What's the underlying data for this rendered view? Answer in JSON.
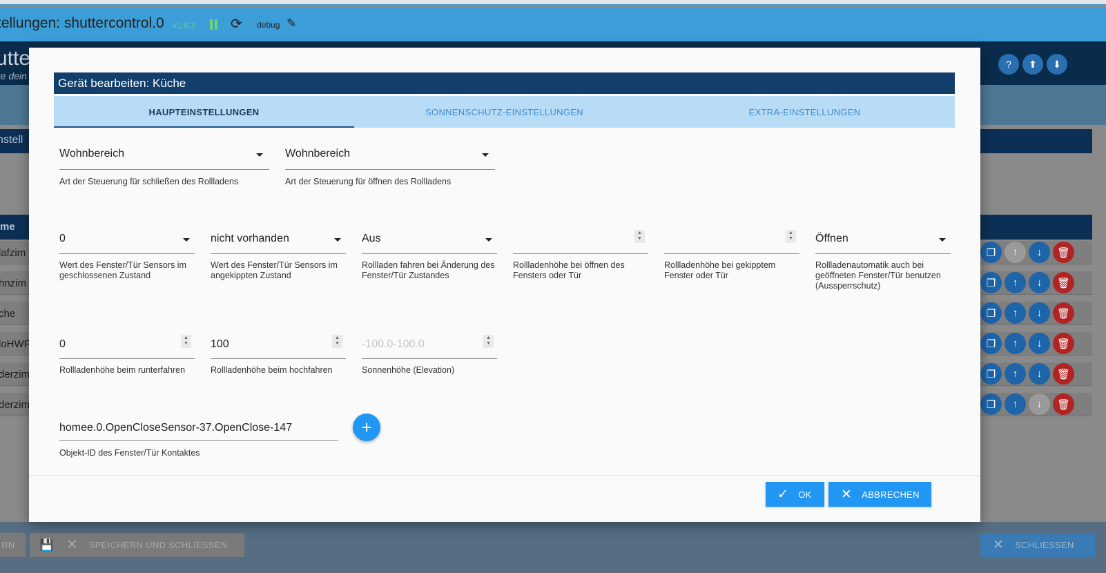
{
  "app": {
    "title": "tellungen: shuttercontrol.0",
    "version": "v1.6.2",
    "debug_label": "debug",
    "header_name": "utte",
    "header_sub": "re dein",
    "section_label": "nstell",
    "table_header": "me",
    "rows": [
      "lafzim",
      "hnzim",
      "che",
      "loHWF",
      "derzim",
      "derzim"
    ]
  },
  "footer": {
    "left_label": "RN",
    "save_close_label": "SPEICHERN UND SCHLIESSEN",
    "close_label": "SCHLIESSEN"
  },
  "dialog": {
    "title": "Gerät bearbeiten: Küche",
    "tabs": [
      {
        "label": "HAUPTEINSTELLUNGEN",
        "active": true
      },
      {
        "label": "SONNENSCHUTZ-EINSTELLUNGEN",
        "active": false
      },
      {
        "label": "EXTRA-EINSTELLUNGEN",
        "active": false
      }
    ],
    "fields": {
      "close_mode": {
        "value": "Wohnbereich",
        "label": "Art der Steuerung für schließen des Rollladens"
      },
      "open_mode": {
        "value": "Wohnbereich",
        "label": "Art der Steuerung für öffnen des Rollladens"
      },
      "sensor_closed": {
        "value": "0",
        "label": "Wert des Fenster/Tür Sensors im geschlossenen Zustand"
      },
      "sensor_tilted": {
        "value": "nicht vorhanden",
        "label": "Wert des Fenster/Tür Sensors im angekippten Zustand"
      },
      "drive_on_change": {
        "value": "Aus",
        "label": "Rollladen fahren bei Änderung des Fenster/Tür Zustandes"
      },
      "height_open": {
        "value": "",
        "label": "Rollladenhöhe bei öffnen des Fensters oder Tür"
      },
      "height_tilted": {
        "value": "",
        "label": "Rollladenhöhe bei gekipptem Fenster oder Tür"
      },
      "lockout": {
        "value": "Öffnen",
        "label": "Rollladenautomatik auch bei geöffneten Fenster/Tür benutzen (Aussperrschutz)"
      },
      "height_down": {
        "value": "0",
        "label": "Rollladenhöhe beim runterfahren"
      },
      "height_up": {
        "value": "100",
        "label": "Rollladenhöhe beim hochfahren"
      },
      "elevation": {
        "value": "",
        "placeholder": "-100.0-100.0",
        "label": "Sonnenhöhe (Elevation)"
      },
      "object_id": {
        "value": "homee.0.OpenCloseSensor-37.OpenClose-147",
        "label": "Objekt-ID des Fenster/Tür Kontaktes"
      }
    },
    "ok_label": "OK",
    "cancel_label": "ABBRECHEN"
  },
  "colors": {
    "titlebar": "#3b9ed8",
    "dialog_title_bg": "#113e6b",
    "tabs_bg": "#b9dcf6",
    "primary_button": "#2196f3"
  },
  "icons": [
    "pause-icon",
    "reload-icon",
    "pencil-icon",
    "help-icon",
    "upload-icon",
    "download-icon",
    "copy-icon",
    "arrow-up-icon",
    "arrow-down-icon",
    "delete-icon",
    "save-icon",
    "close-icon",
    "check-icon",
    "plus-icon",
    "caret-down-icon",
    "spinner-icon"
  ]
}
